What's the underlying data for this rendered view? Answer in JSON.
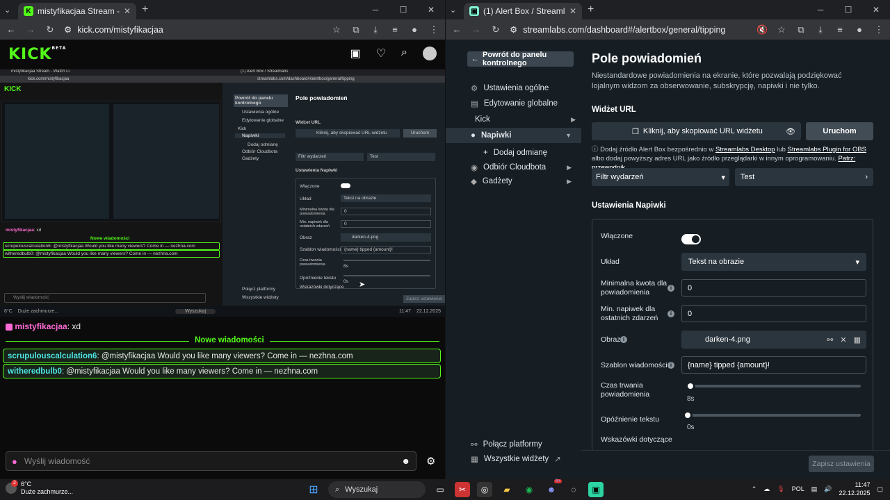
{
  "left_window": {
    "tab_title": "mistyfikacjaa Stream - Watch Li",
    "url": "kick.com/mistyfikacjaa",
    "kick_logo": "KICK",
    "kick_logo_badge": "BETA",
    "chat": {
      "first_user": "mistyfikacjaa",
      "first_text": ": xd",
      "new_messages_label": "Nowe wiadomości",
      "messages": [
        {
          "user": "scrupulouscalculation6",
          "text": ": @mistyfikacjaa Would you like many viewers? Come in — nezhna.com"
        },
        {
          "user": "witheredbulb0",
          "text": ": @mistyfikacjaa Would you like many viewers? Come in — nezhna.com"
        }
      ],
      "input_placeholder": "Wyślij wiadomość"
    },
    "stream_mini": {
      "heading": "Pole powiadomień",
      "back": "Powrót do panelu kontrolnego",
      "nav": [
        "Ustawienia ogólne",
        "Edytowanie globalne",
        "Kick",
        "Napiwki",
        "Dodaj odmianę",
        "Odbiór Cloudbota",
        "Gadżety"
      ],
      "widget_label": "Widżet URL",
      "copy": "Kliknij, aby skopiować URL widżetu",
      "run": "Uruchom",
      "filter": "Filtr wydarzeń",
      "test": "Test",
      "settings": "Ustawienia Napiwki",
      "rows": [
        "Włączone",
        "Układ",
        "Minimalna kwota dla powiadomienia",
        "Min. napiwek dla ostatnich zdarzeń",
        "Obraz",
        "Szablon wiadomości",
        "Czas trwania powiadomienia",
        "Opóźnienie tekstu",
        "Wskazówki dotyczące"
      ],
      "values": [
        "Tekst na obrazie",
        "0",
        "0",
        "darken-4.png",
        "{name} tipped {amount}!",
        "8s",
        "0s"
      ],
      "bottom": [
        "Połącz platformy",
        "Wszystkie widżety"
      ],
      "save": "Zapisz ustawienia",
      "chat_user": "mistyfikacjaa",
      "chat_text": ": xd",
      "chat_msgs": [
        "scrupulouscalculation6: @mistyfikacjaa Would you like many viewers? Come in — nezhna.com",
        "witheredbulb0: @mistyfikacjaa Would you like many viewers? Come in — nezhna.com"
      ],
      "chat_input": "Wyślij wiadomość",
      "search": "Wyszukaj",
      "weather_temp": "6°C",
      "weather_desc": "Duże zachmurze...",
      "time": "11:47",
      "date": "22.12.2025",
      "tab1": "mistyfikacjaa Stream - Watch Li",
      "tab2": "(1) Alert Box / Streamlabs",
      "url1": "kick.com/mistyfikacjaa",
      "url2": "streamlabs.com/dashboard#/alertbox/general/tipping"
    }
  },
  "right_window": {
    "tab_title": "(1) Alert Box / Streamlabs",
    "url": "streamlabs.com/dashboard#/alertbox/general/tipping",
    "back_button": "Powrót do panelu kontrolnego",
    "nav": [
      {
        "label": "Ustawienia ogólne"
      },
      {
        "label": "Edytowanie globalne"
      },
      {
        "label": "Kick"
      },
      {
        "label": "Napiwki"
      },
      {
        "label": "Dodaj odmianę"
      },
      {
        "label": "Odbiór Cloudbota"
      },
      {
        "label": "Gadżety"
      }
    ],
    "bottom_nav": [
      "Połącz platformy",
      "Wszystkie widżety"
    ],
    "title": "Pole powiadomień",
    "subtitle": "Niestandardowe powiadomienia na ekranie, które pozwalają podziękować lojalnym widzom za obserwowanie, subskrypcję, napiwki i nie tylko.",
    "widget_label": "Widżet URL",
    "copy_label": "Kliknij, aby skopiować URL widżetu",
    "run_button": "Uruchom",
    "note": {
      "t1": "Dodaj źródło Alert Box bezpośrednio w ",
      "l1": "Streamlabs Desktop",
      "t2": " lub ",
      "l2": "Streamlabs Plugin for OBS",
      "t3": " albo dodaj powyższy adres URL jako źródło przeglądarki w innym oprogramowaniu. ",
      "l3": "Patrz: przewodnik"
    },
    "filter_button": "Filtr wydarzeń",
    "test_button": "Test",
    "settings_title": "Ustawienia Napiwki",
    "settings": {
      "enabled": "Włączone",
      "layout": "Układ",
      "layout_value": "Tekst na obrazie",
      "min_amount": "Minimalna kwota dla powiadomienia",
      "min_amount_value": "0",
      "min_recent": "Min. napiwek dla ostatnich zdarzeń",
      "min_recent_value": "0",
      "image": "Obraz",
      "image_value": "darken-4.png",
      "template": "Szablon wiadomości",
      "template_value": "{name} tipped {amount}!",
      "duration": "Czas trwania powiadomienia",
      "duration_value": "8s",
      "delay": "Opóźnienie tekstu",
      "delay_value": "0s",
      "hints": "Wskazówki dotyczące"
    },
    "save_button": "Zapisz ustawienia"
  },
  "taskbar": {
    "weather_temp": "6°C",
    "weather_desc": "Duże zachmurze...",
    "search": "Wyszukaj",
    "lang": "POL",
    "time": "11:47",
    "date": "22.12.2025",
    "badge_discord": "9+",
    "weather_badge": "2"
  }
}
